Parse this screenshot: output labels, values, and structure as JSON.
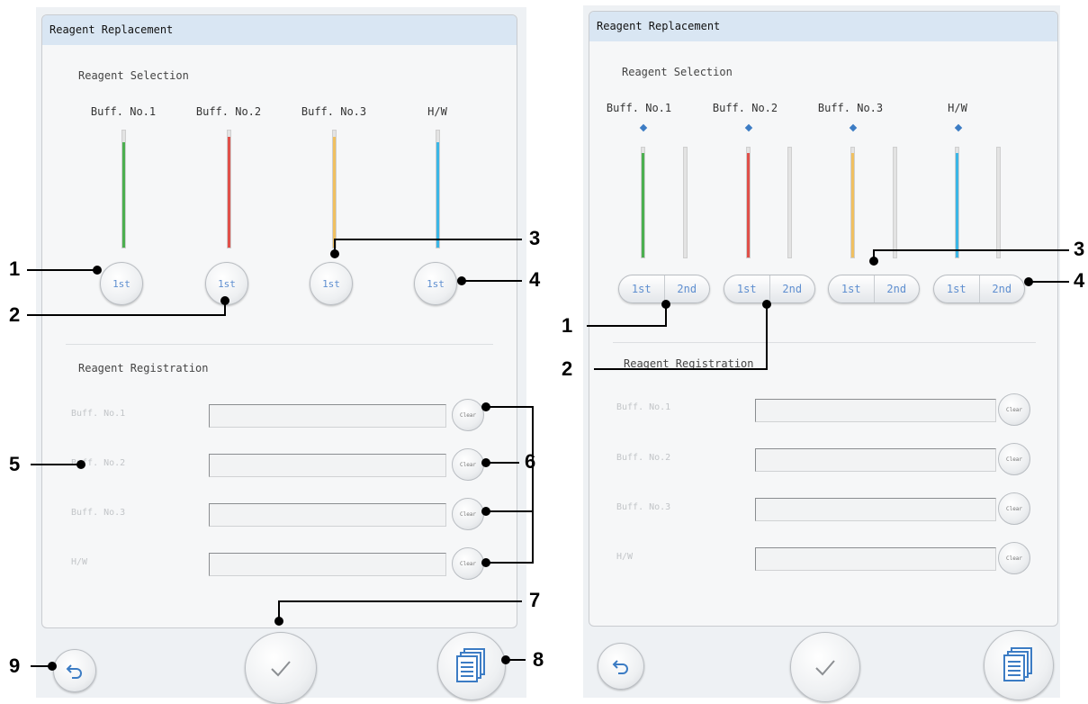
{
  "left_screen": {
    "title": "Reagent Replacement",
    "selection_label": "Reagent Selection",
    "reagents": [
      {
        "label": "Buff. No.1",
        "color": "#4caf50",
        "level": 0.9,
        "button": "1st"
      },
      {
        "label": "Buff. No.2",
        "color": "#e0504a",
        "level": 0.95,
        "button": "1st"
      },
      {
        "label": "Buff. No.3",
        "color": "#f0c060",
        "level": 0.95,
        "button": "1st"
      },
      {
        "label": "H/W",
        "color": "#3bb6e6",
        "level": 0.9,
        "button": "1st"
      }
    ],
    "registration_label": "Reagent Registration",
    "registration_rows": [
      {
        "label": "Buff. No.1",
        "value": "",
        "clear": "Clear"
      },
      {
        "label": "Buff. No.2",
        "value": "",
        "clear": "Clear"
      },
      {
        "label": "Buff. No.3",
        "value": "",
        "clear": "Clear"
      },
      {
        "label": "H/W",
        "value": "",
        "clear": "Clear"
      }
    ]
  },
  "right_screen": {
    "title": "Reagent Replacement",
    "selection_label": "Reagent Selection",
    "reagents": [
      {
        "label": "Buff. No.1",
        "color": "#4caf50",
        "level": 0.95,
        "btn1": "1st",
        "btn2": "2nd"
      },
      {
        "label": "Buff. No.2",
        "color": "#e0504a",
        "level": 0.95,
        "btn1": "1st",
        "btn2": "2nd"
      },
      {
        "label": "Buff. No.3",
        "color": "#f0c060",
        "level": 0.95,
        "btn1": "1st",
        "btn2": "2nd"
      },
      {
        "label": "H/W",
        "color": "#3bb6e6",
        "level": 0.95,
        "btn1": "1st",
        "btn2": "2nd"
      }
    ],
    "registration_label": "Reagent Registration",
    "registration_rows": [
      {
        "label": "Buff. No.1",
        "value": "",
        "clear": "Clear"
      },
      {
        "label": "Buff. No.2",
        "value": "",
        "clear": "Clear"
      },
      {
        "label": "Buff. No.3",
        "value": "",
        "clear": "Clear"
      },
      {
        "label": "H/W",
        "value": "",
        "clear": "Clear"
      }
    ]
  },
  "callouts": {
    "left": [
      "1",
      "2",
      "3",
      "4",
      "5",
      "6",
      "7",
      "8",
      "9"
    ],
    "right": [
      "1",
      "2",
      "3",
      "4"
    ]
  },
  "icons": {
    "back": "undo-arrow-icon",
    "confirm": "checkmark-icon",
    "menu": "document-list-icon",
    "accent": "#3c7cc4"
  }
}
